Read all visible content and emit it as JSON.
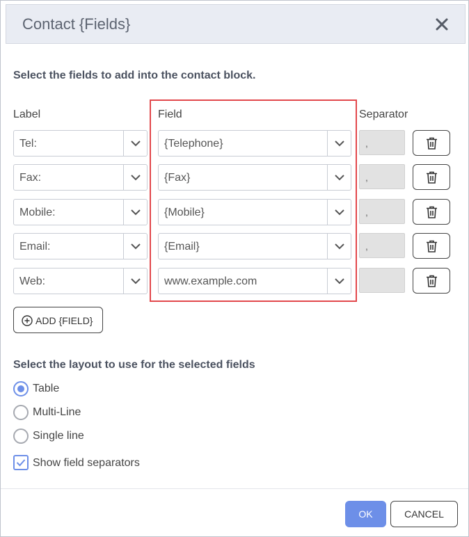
{
  "dialog": {
    "title": "Contact {Fields}"
  },
  "instructions": "Select the fields to add into the contact block.",
  "columns": {
    "label": "Label",
    "field": "Field",
    "separator": "Separator"
  },
  "rows": [
    {
      "label": "Tel:",
      "field": "{Telephone}",
      "separator": ","
    },
    {
      "label": "Fax:",
      "field": "{Fax}",
      "separator": ","
    },
    {
      "label": "Mobile:",
      "field": "{Mobile}",
      "separator": ","
    },
    {
      "label": "Email:",
      "field": "{Email}",
      "separator": ","
    },
    {
      "label": "Web:",
      "field": "www.example.com",
      "separator": ""
    }
  ],
  "add_field_label": "ADD {FIELD}",
  "layout": {
    "title": "Select the layout to use for the selected fields",
    "options": [
      "Table",
      "Multi-Line",
      "Single line"
    ],
    "selected": "Table"
  },
  "show_separators": {
    "label": "Show field separators",
    "checked": true
  },
  "buttons": {
    "ok": "OK",
    "cancel": "CANCEL"
  },
  "colors": {
    "accent": "#6d8fe8",
    "highlight_border": "#e2474b",
    "header_bg": "#e9ecf3"
  },
  "icons": {
    "close": "close-icon",
    "dropdown": "chevron-down-icon",
    "delete": "trash-icon",
    "add": "plus-circle-icon",
    "check": "checkmark-icon"
  }
}
